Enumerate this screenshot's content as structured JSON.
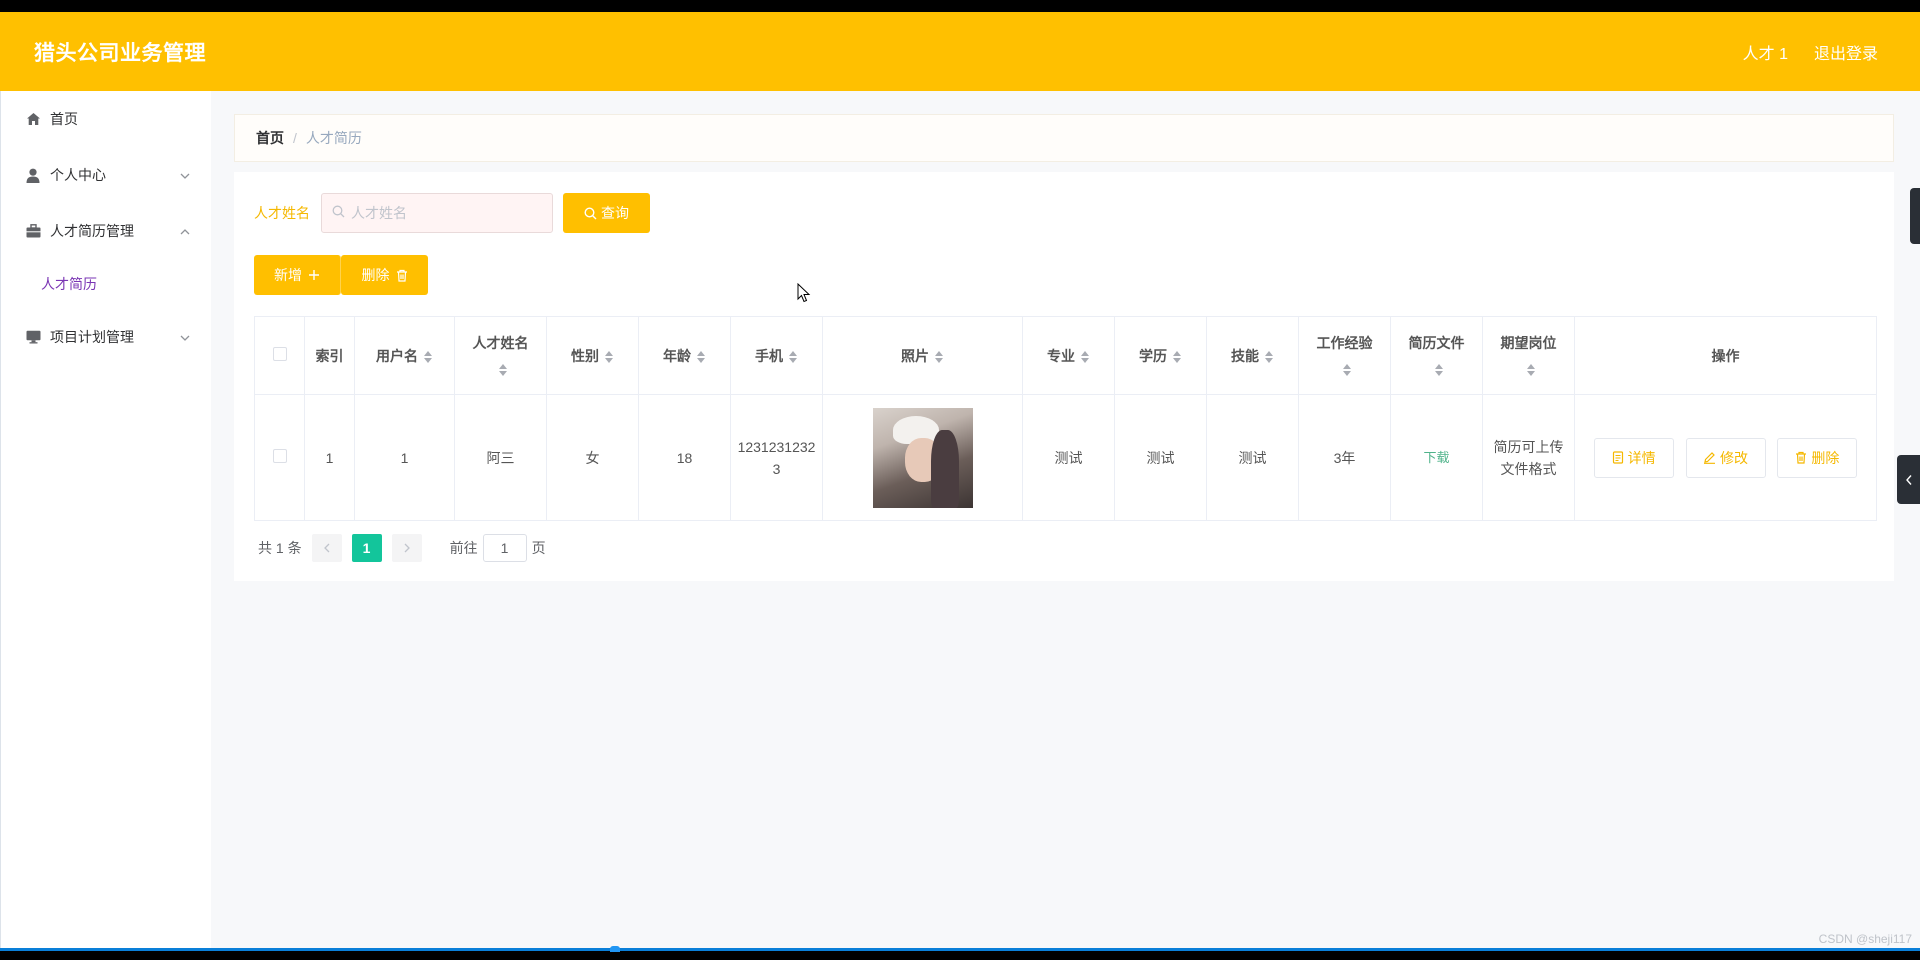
{
  "app": {
    "title": "猎头公司业务管理"
  },
  "header": {
    "user": "人才 1",
    "logout": "退出登录"
  },
  "sidebar": {
    "items": [
      {
        "label": "首页",
        "icon": "home-icon"
      },
      {
        "label": "个人中心",
        "icon": "user-icon"
      },
      {
        "label": "人才简历管理",
        "icon": "briefcase-icon"
      },
      {
        "label": "项目计划管理",
        "icon": "monitor-icon"
      }
    ],
    "sub_items": [
      {
        "label": "人才简历"
      }
    ]
  },
  "breadcrumb": {
    "home": "首页",
    "sep": "/",
    "current": "人才简历"
  },
  "search": {
    "label": "人才姓名",
    "placeholder": "人才姓名",
    "button": "查询"
  },
  "actions": {
    "add": "新增",
    "delete": "删除"
  },
  "table": {
    "headers": [
      "索引",
      "用户名",
      "人才姓名",
      "性别",
      "年龄",
      "手机",
      "照片",
      "专业",
      "学历",
      "技能",
      "工作经验",
      "简历文件",
      "期望岗位",
      "操作"
    ],
    "rows": [
      {
        "index": "1",
        "username": "1",
        "name": "阿三",
        "gender": "女",
        "age": "18",
        "phone": "12312312323",
        "major": "测试",
        "education": "测试",
        "skills": "测试",
        "experience": "3年",
        "resume": "下载",
        "position": "简历可上传文件格式",
        "ops": {
          "detail": "详情",
          "edit": "修改",
          "delete": "删除"
        }
      }
    ]
  },
  "pagination": {
    "total": "共 1 条",
    "current": "1",
    "goto_prefix": "前往",
    "goto_value": "1",
    "goto_suffix": "页"
  },
  "watermark": "CSDN @sheji117",
  "colors": {
    "primary": "#ffc000",
    "accent": "#13c59b",
    "link": "#4fb38a",
    "submenu": "#7a35b4"
  }
}
